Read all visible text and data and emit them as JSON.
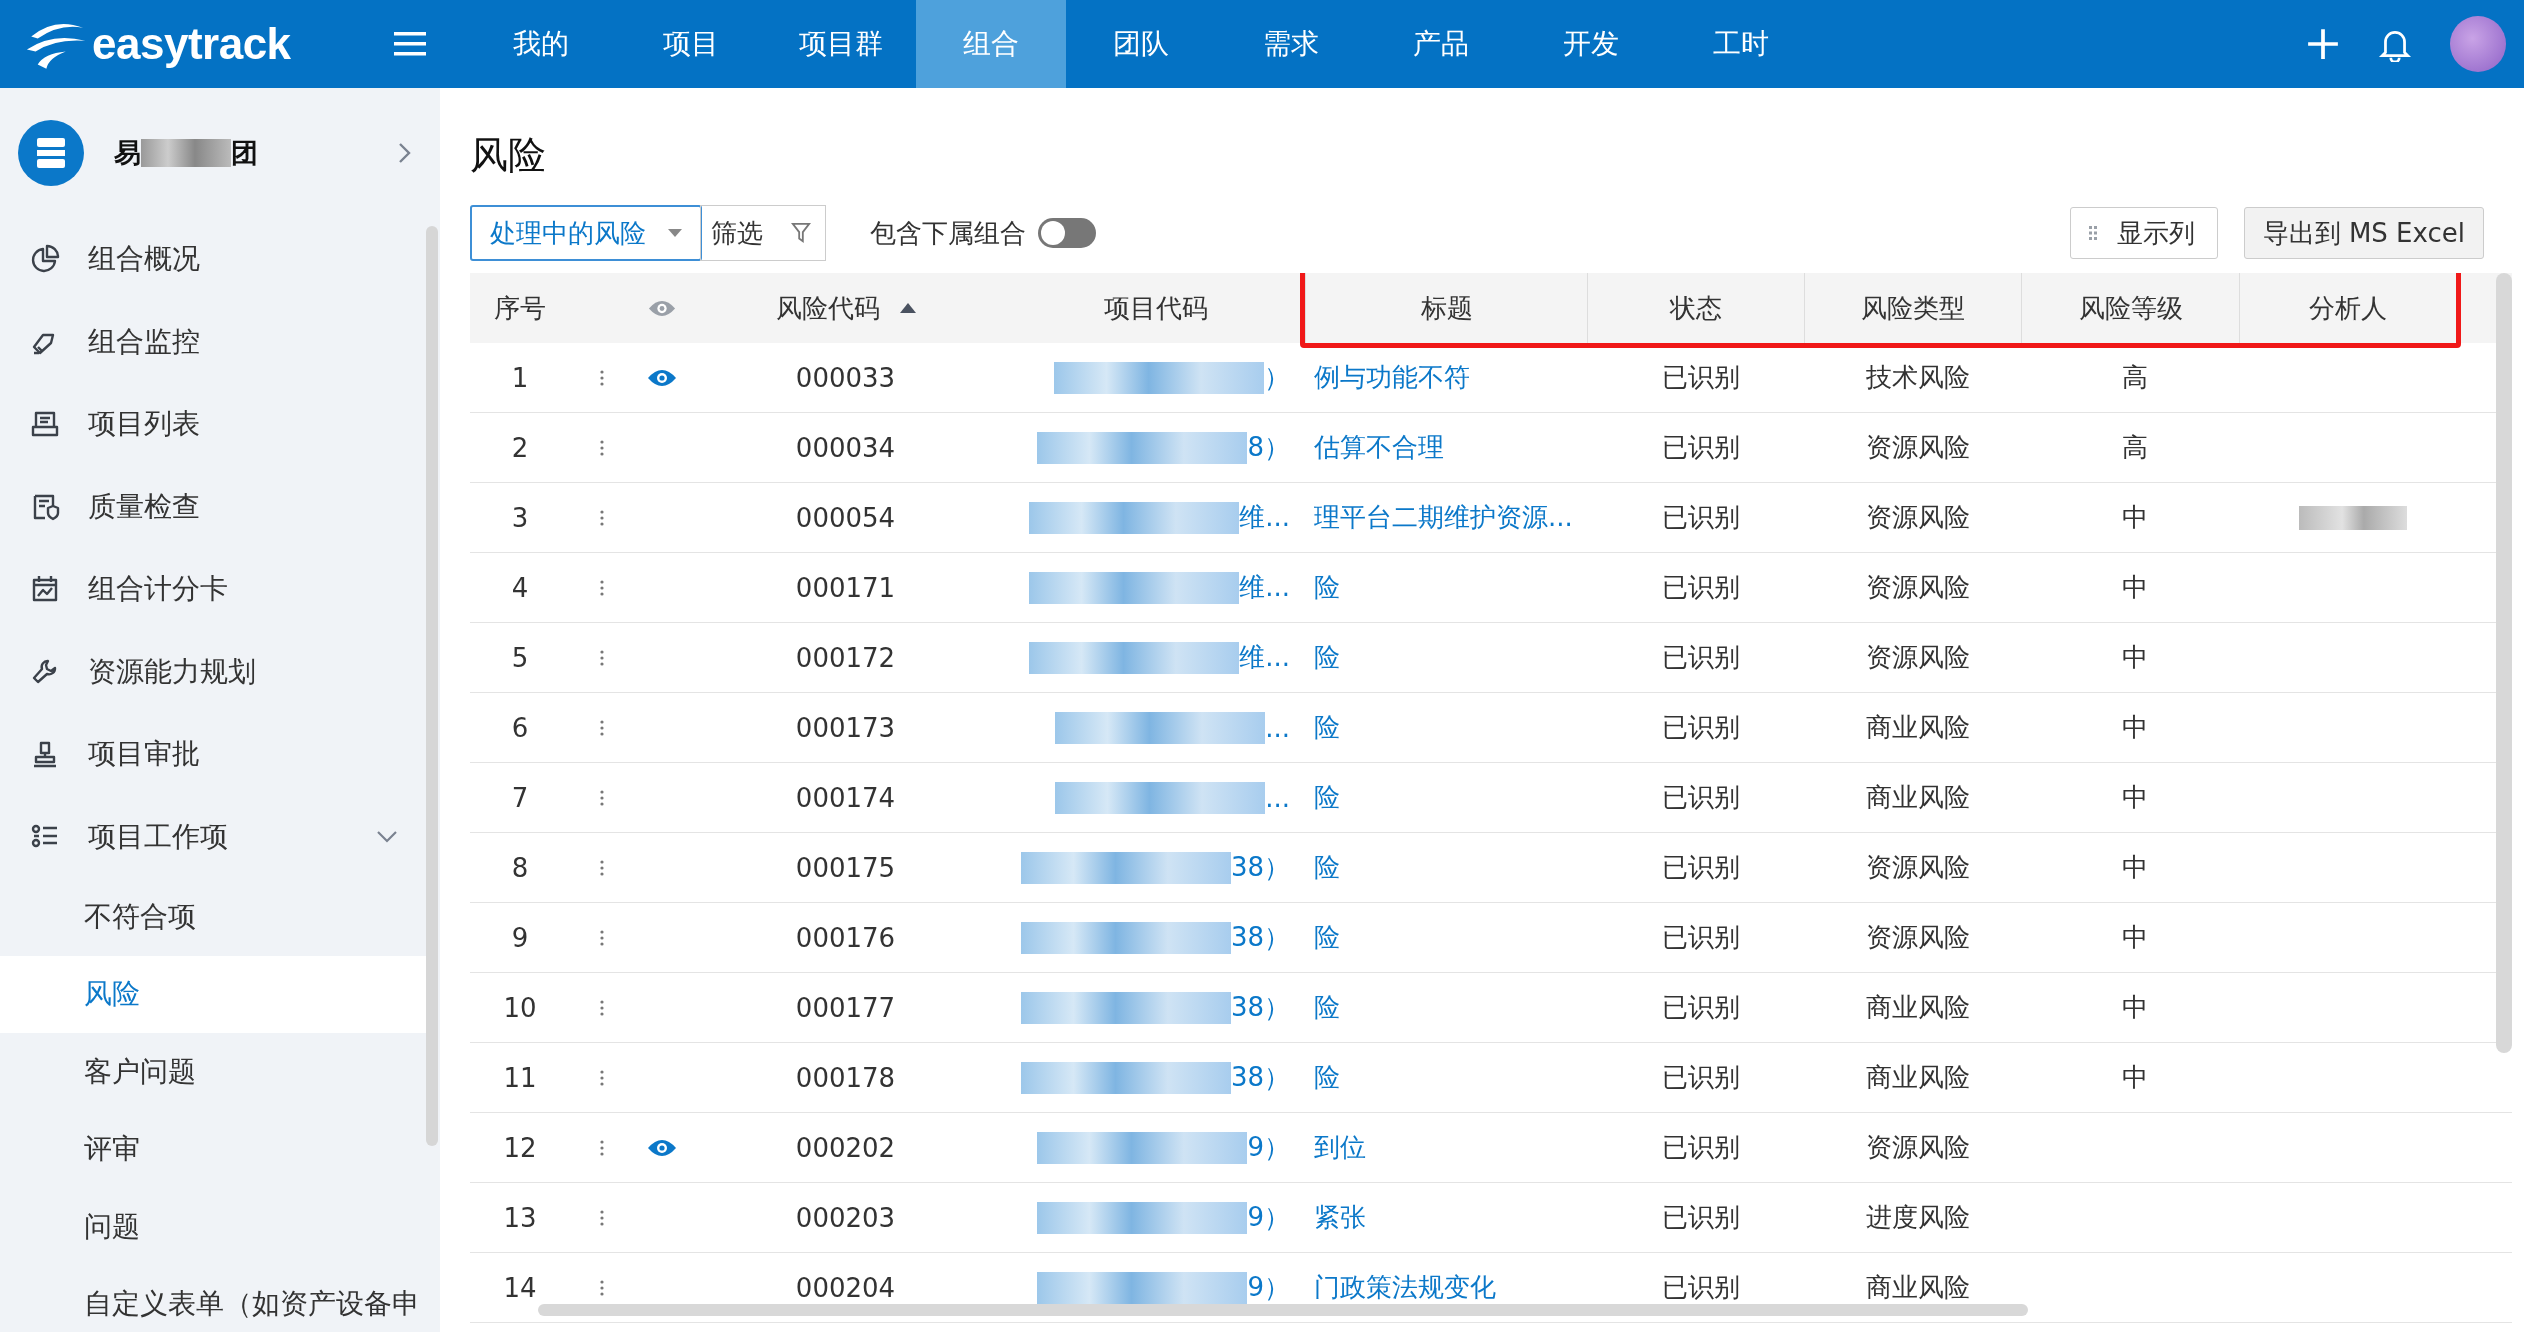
{
  "brand": "easytrack",
  "nav": [
    {
      "label": "我的",
      "selected": false
    },
    {
      "label": "项目",
      "selected": false
    },
    {
      "label": "项目群",
      "selected": false
    },
    {
      "label": "组合",
      "selected": true
    },
    {
      "label": "团队",
      "selected": false
    },
    {
      "label": "需求",
      "selected": false
    },
    {
      "label": "产品",
      "selected": false
    },
    {
      "label": "开发",
      "selected": false
    },
    {
      "label": "工时",
      "selected": false
    }
  ],
  "org": {
    "prefix": "易",
    "suffix": "团"
  },
  "sidebar": [
    {
      "label": "组合概况",
      "kind": "pie",
      "selected": false
    },
    {
      "label": "组合监控",
      "kind": "tag",
      "selected": false
    },
    {
      "label": "项目列表",
      "kind": "list",
      "selected": false
    },
    {
      "label": "质量检查",
      "kind": "shield",
      "selected": false
    },
    {
      "label": "组合计分卡",
      "kind": "calendar",
      "selected": false
    },
    {
      "label": "资源能力规划",
      "kind": "wrench",
      "selected": false
    },
    {
      "label": "项目审批",
      "kind": "stamp",
      "selected": false
    },
    {
      "label": "项目工作项",
      "kind": "bullets",
      "selected": false,
      "expanded": true,
      "children": [
        {
          "label": "不符合项",
          "selected": false
        },
        {
          "label": "风险",
          "selected": true
        },
        {
          "label": "客户问题",
          "selected": false
        },
        {
          "label": "评审",
          "selected": false
        },
        {
          "label": "问题",
          "selected": false
        },
        {
          "label": "自定义表单（如资产设备申",
          "selected": false
        }
      ]
    }
  ],
  "page_title": "风险",
  "toolbar": {
    "view": "处理中的风险",
    "filter": "筛选",
    "include_sub": {
      "label": "包含下属组合",
      "on": false
    },
    "columns_button": "显示列",
    "export_button": "导出到 MS Excel"
  },
  "table": {
    "columns": [
      {
        "label": "序号",
        "highlighted": false
      },
      {
        "kind": "dots",
        "highlighted": false
      },
      {
        "kind": "eye",
        "highlighted": false
      },
      {
        "label": "风险代码",
        "sorted": true,
        "highlighted": false
      },
      {
        "label": "项目代码",
        "highlighted": false
      },
      {
        "label": "标题",
        "highlighted": true
      },
      {
        "label": "状态",
        "highlighted": true
      },
      {
        "label": "风险类型",
        "highlighted": true
      },
      {
        "label": "风险等级",
        "highlighted": true
      },
      {
        "label": "分析人",
        "highlighted": true
      }
    ],
    "rows": [
      {
        "index": "1",
        "watched": true,
        "code": "000033",
        "project_tail": "）",
        "title": "例与功能不符",
        "status": "已识别",
        "type": "技术风险",
        "level": "高",
        "analyst_redacted": false
      },
      {
        "index": "2",
        "watched": false,
        "code": "000034",
        "project_tail": "8）",
        "title": "估算不合理",
        "status": "已识别",
        "type": "资源风险",
        "level": "高",
        "analyst_redacted": false
      },
      {
        "index": "3",
        "watched": false,
        "code": "000054",
        "project_tail": "维...",
        "title": "理平台二期维护资源...",
        "status": "已识别",
        "type": "资源风险",
        "level": "中",
        "analyst_redacted": true
      },
      {
        "index": "4",
        "watched": false,
        "code": "000171",
        "project_tail": "维...",
        "title": "险",
        "status": "已识别",
        "type": "资源风险",
        "level": "中",
        "analyst_redacted": false
      },
      {
        "index": "5",
        "watched": false,
        "code": "000172",
        "project_tail": "维...",
        "title": "险",
        "status": "已识别",
        "type": "资源风险",
        "level": "中",
        "analyst_redacted": false
      },
      {
        "index": "6",
        "watched": false,
        "code": "000173",
        "project_tail": "...",
        "title": "险",
        "status": "已识别",
        "type": "商业风险",
        "level": "中",
        "analyst_redacted": false
      },
      {
        "index": "7",
        "watched": false,
        "code": "000174",
        "project_tail": "...",
        "title": "险",
        "status": "已识别",
        "type": "商业风险",
        "level": "中",
        "analyst_redacted": false
      },
      {
        "index": "8",
        "watched": false,
        "code": "000175",
        "project_tail": "38）",
        "title": "险",
        "status": "已识别",
        "type": "资源风险",
        "level": "中",
        "analyst_redacted": false
      },
      {
        "index": "9",
        "watched": false,
        "code": "000176",
        "project_tail": "38）",
        "title": "险",
        "status": "已识别",
        "type": "资源风险",
        "level": "中",
        "analyst_redacted": false
      },
      {
        "index": "10",
        "watched": false,
        "code": "000177",
        "project_tail": "38）",
        "title": "险",
        "status": "已识别",
        "type": "商业风险",
        "level": "中",
        "analyst_redacted": false
      },
      {
        "index": "11",
        "watched": false,
        "code": "000178",
        "project_tail": "38）",
        "title": "险",
        "status": "已识别",
        "type": "商业风险",
        "level": "中",
        "analyst_redacted": false
      },
      {
        "index": "12",
        "watched": true,
        "code": "000202",
        "project_tail": "9）",
        "title": "到位",
        "status": "已识别",
        "type": "资源风险",
        "level": "",
        "analyst_redacted": false
      },
      {
        "index": "13",
        "watched": false,
        "code": "000203",
        "project_tail": "9）",
        "title": "紧张",
        "status": "已识别",
        "type": "进度风险",
        "level": "",
        "analyst_redacted": false
      },
      {
        "index": "14",
        "watched": false,
        "code": "000204",
        "project_tail": "9）",
        "title": "门政策法规变化",
        "status": "已识别",
        "type": "商业风险",
        "level": "",
        "analyst_redacted": false
      }
    ]
  }
}
